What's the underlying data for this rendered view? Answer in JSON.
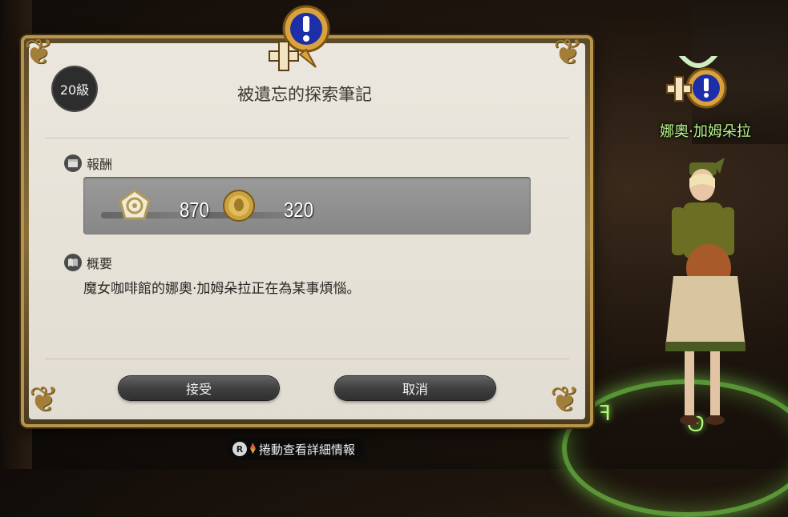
{
  "npc": {
    "name": "娜奧·加姆朵拉"
  },
  "quest": {
    "level": "20級",
    "title": "被遺忘的探索筆記",
    "rewards_heading": "報酬",
    "rewards": [
      {
        "icon": "experience-emblem-icon",
        "value": "870"
      },
      {
        "icon": "gil-coin-icon",
        "value": "320"
      }
    ],
    "summary_heading": "概要",
    "summary_text": "魔女咖啡館的娜奧·加姆朵拉正在為某事煩惱。",
    "accept_label": "接受",
    "cancel_label": "取消"
  },
  "hint": {
    "button_glyph": "R",
    "text": "捲動查看詳細情報"
  },
  "colors": {
    "frame_gold": "#b8954b",
    "paper": "#ebe7de",
    "npc_name": "#b7f58b",
    "quest_icon_blue": "#1c2fa8"
  }
}
